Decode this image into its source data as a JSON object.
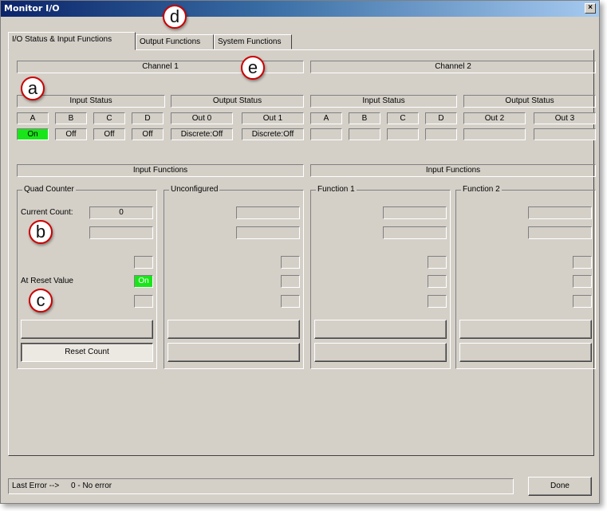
{
  "window": {
    "title": "Monitor I/O",
    "close_glyph": "×"
  },
  "tabs": [
    {
      "label": "I/O Status & Input Functions",
      "active": true
    },
    {
      "label": "Output Functions",
      "active": false
    },
    {
      "label": "System Functions",
      "active": false
    }
  ],
  "channels": [
    {
      "title": "Channel 1",
      "input_status_title": "Input Status",
      "output_status_title": "Output Status",
      "inputs": [
        {
          "name": "A",
          "value": "On",
          "on": true
        },
        {
          "name": "B",
          "value": "Off",
          "on": false
        },
        {
          "name": "C",
          "value": "Off",
          "on": false
        },
        {
          "name": "D",
          "value": "Off",
          "on": false
        }
      ],
      "outputs": [
        {
          "name": "Out 0",
          "value": "Discrete:Off"
        },
        {
          "name": "Out 1",
          "value": "Discrete:Off"
        }
      ],
      "input_functions_title": "Input Functions",
      "functions": [
        {
          "title": "Quad Counter",
          "current_count_label": "Current Count:",
          "current_count_value": "0",
          "reset_label": "At Reset Value",
          "reset_value": "On",
          "reset_button": "Reset Count"
        },
        {
          "title": "Unconfigured"
        }
      ]
    },
    {
      "title": "Channel 2",
      "input_status_title": "Input Status",
      "output_status_title": "Output Status",
      "inputs": [
        {
          "name": "A",
          "value": ""
        },
        {
          "name": "B",
          "value": ""
        },
        {
          "name": "C",
          "value": ""
        },
        {
          "name": "D",
          "value": ""
        }
      ],
      "outputs": [
        {
          "name": "Out 2",
          "value": ""
        },
        {
          "name": "Out 3",
          "value": ""
        }
      ],
      "input_functions_title": "Input Functions",
      "functions": [
        {
          "title": "Function 1"
        },
        {
          "title": "Function 2"
        }
      ]
    }
  ],
  "status_bar": {
    "label": "Last Error -->",
    "value": "0 - No error",
    "done_button": "Done"
  },
  "callouts": [
    "a",
    "b",
    "c",
    "d",
    "e"
  ],
  "colors": {
    "on_green": "#19e619",
    "badge_border": "#cc0000",
    "title_bar": "#0a246a"
  }
}
